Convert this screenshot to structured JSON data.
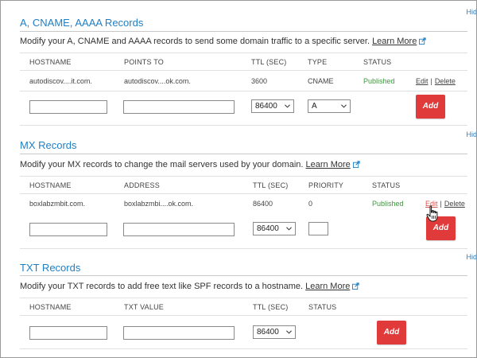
{
  "hide_label": "Hid",
  "sections": {
    "a_records": {
      "title": "A, CNAME, AAAA Records",
      "description": "Modify your A, CNAME and AAAA records to send some domain traffic to a specific server.",
      "learn_more": "Learn More",
      "headers": {
        "hostname": "HOSTNAME",
        "points_to": "POINTS TO",
        "ttl": "TTL (SEC)",
        "type": "TYPE",
        "status": "STATUS"
      },
      "record": {
        "hostname": "autodiscov....it.com.",
        "points_to": "autodiscov....ok.com.",
        "ttl": "3600",
        "type": "CNAME",
        "status": "Published",
        "edit": "Edit",
        "delete": "Delete"
      },
      "new_row": {
        "hostname_value": "",
        "points_to_value": "",
        "ttl_selected": "86400",
        "type_selected": "A",
        "add_label": "Add"
      }
    },
    "mx_records": {
      "title": "MX Records",
      "description": "Modify your MX records to change the mail servers used by your domain.",
      "learn_more": "Learn More",
      "headers": {
        "hostname": "HOSTNAME",
        "address": "ADDRESS",
        "ttl": "TTL (SEC)",
        "priority": "PRIORITY",
        "status": "STATUS"
      },
      "record": {
        "hostname": "boxlabzmbit.com.",
        "address": "boxlabzmbi....ok.com.",
        "ttl": "86400",
        "priority": "0",
        "status": "Published",
        "edit": "Edit",
        "delete": "Delete"
      },
      "new_row": {
        "hostname_value": "",
        "address_value": "",
        "ttl_selected": "86400",
        "priority_value": "",
        "add_label": "Add"
      }
    },
    "txt_records": {
      "title": "TXT Records",
      "description": "Modify your TXT records to add free text like SPF records to a hostname.",
      "learn_more": "Learn More",
      "headers": {
        "hostname": "HOSTNAME",
        "txt_value": "TXT VALUE",
        "ttl": "TTL (SEC)",
        "status": "STATUS"
      },
      "new_row": {
        "hostname_value": "",
        "txt_value_value": "",
        "ttl_selected": "86400",
        "add_label": "Add"
      }
    }
  },
  "colors": {
    "accent": "#1f7fc4",
    "published": "#3c9a3c",
    "add_button": "#e03a3a",
    "hover_link": "#d9534f"
  },
  "icons": {
    "external_link": "external-link-icon",
    "dropdown": "chevron-down-icon",
    "cursor": "hand-pointer-icon"
  }
}
